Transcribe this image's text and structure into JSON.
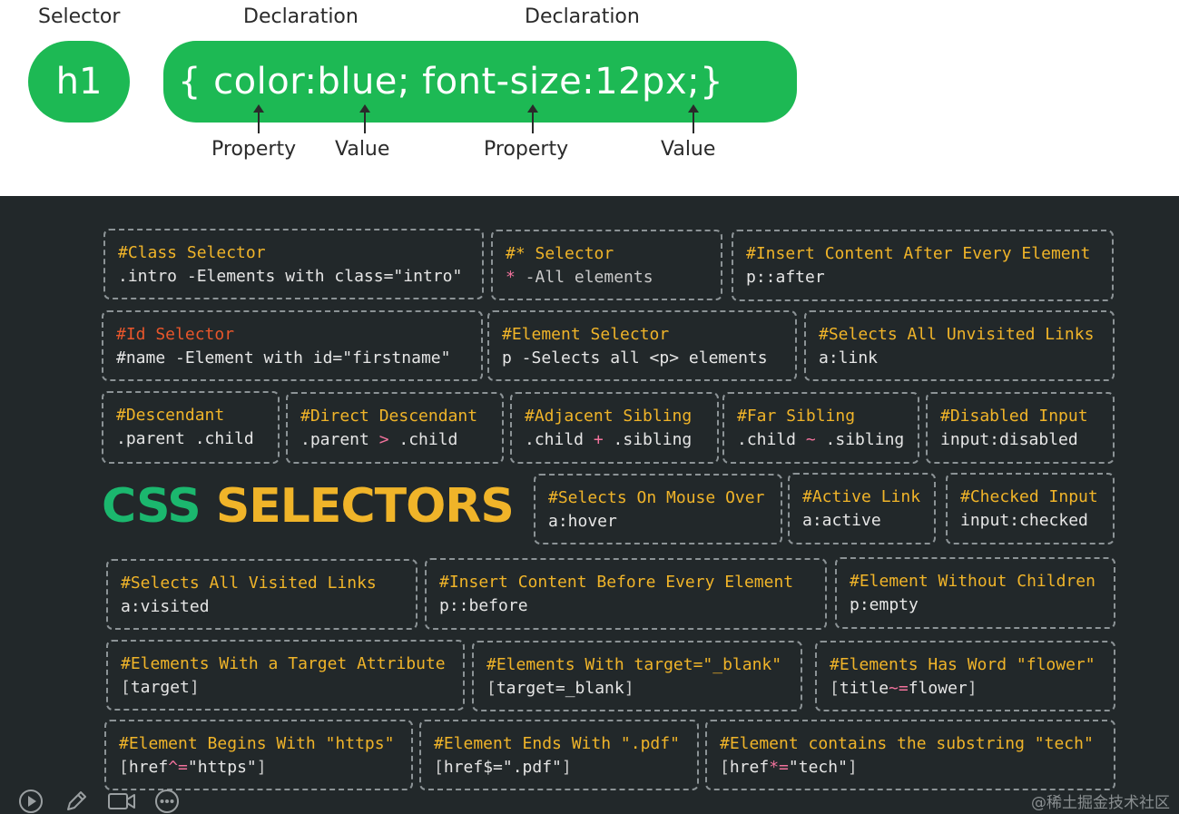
{
  "anatomy": {
    "selector_label": "Selector",
    "declaration_labels": [
      "Declaration",
      "Declaration"
    ],
    "selector": "h1",
    "declaration_text": "{ color:blue; font-size:12px;}",
    "property_labels": [
      "Property",
      "Property"
    ],
    "value_labels": [
      "Value",
      "Value"
    ],
    "pill_color": "#1db954"
  },
  "sheet": {
    "title_css": "CSS",
    "title_selectors": "SELECTORS",
    "boxes": [
      {
        "title": "#Class Selector",
        "code": ".intro -Elements with class=\"intro\""
      },
      {
        "title": "#* Selector",
        "code_pre": "*",
        "code": "  -All elements"
      },
      {
        "title": "#Insert Content After Every Element",
        "code": "p::after"
      },
      {
        "title": "#Id Selector",
        "code": "#name  -Element with id=\"firstname\""
      },
      {
        "title": "#Element Selector",
        "code": "p  -Selects all <p> elements"
      },
      {
        "title": "#Selects All Unvisited Links",
        "code": "a:link"
      },
      {
        "title": "#Descendant",
        "code": ".parent .child"
      },
      {
        "title": "#Direct Descendant",
        "code_a": ".parent",
        "code_op": " > ",
        "code_b": ".child"
      },
      {
        "title": "#Adjacent Sibling",
        "code_a": ".child",
        "code_op": " + ",
        "code_b": ".sibling"
      },
      {
        "title": "#Far Sibling",
        "code_a": ".child",
        "code_op": " ~ ",
        "code_b": ".sibling"
      },
      {
        "title": "#Disabled Input",
        "code": "input:disabled"
      },
      {
        "title": "#Selects On Mouse Over",
        "code": "a:hover"
      },
      {
        "title": "#Active Link",
        "code": "a:active"
      },
      {
        "title": "#Checked Input",
        "code": "input:checked"
      },
      {
        "title": "#Selects All Visited Links",
        "code": "a:visited"
      },
      {
        "title": "#Insert Content Before Every Element",
        "code": "p::before"
      },
      {
        "title": "#Element Without Children",
        "code": "p:empty"
      },
      {
        "title": "#Elements With a Target Attribute",
        "code_a": "[",
        "code_b": "target",
        "code_c": "]"
      },
      {
        "title": "#Elements With target=\"_blank\"",
        "code_a": "[",
        "code_b": "target=_blank",
        "code_c": "]"
      },
      {
        "title": "#Elements Has Word \"flower\"",
        "code_a": "[",
        "code_b": "title",
        "code_op": "~=",
        "code_c": "flower",
        "code_d": "]"
      },
      {
        "title": "#Element Begins With \"https\"",
        "code_a": "[",
        "code_b": "href",
        "code_op": "^=",
        "code_c": "\"https\"",
        "code_d": "]"
      },
      {
        "title": "#Element Ends With \".pdf\"",
        "code_a": "[",
        "code_b": "href$=",
        "code_c": "\".pdf\"",
        "code_d": "]"
      },
      {
        "title": "#Element contains the substring \"tech\"",
        "code_a": "[",
        "code_b": "href",
        "code_op": "*=",
        "code_c": "\"tech\"",
        "code_d": "]"
      }
    ],
    "colors": {
      "background": "#22282a",
      "title_yellow": "#f0b429",
      "title_green": "#1bb76e",
      "id_red": "#e8562b",
      "operator_pink": "#f2729c"
    },
    "watermark": "@稀土掘金技术社区",
    "toolbar_icons": [
      "play-icon",
      "pencil-icon",
      "camera-icon",
      "more-icon"
    ]
  }
}
